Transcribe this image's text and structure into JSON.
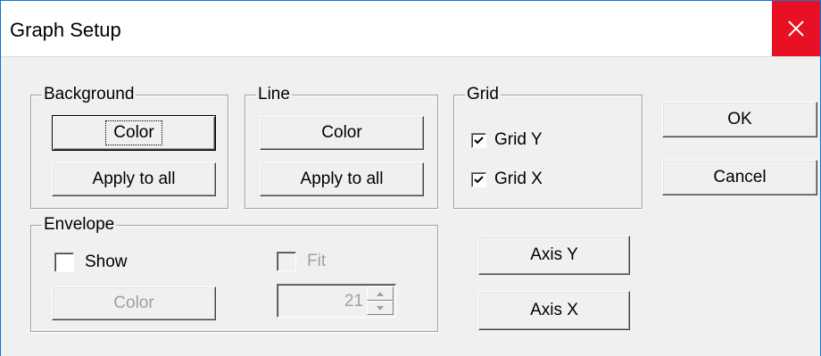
{
  "window": {
    "title": "Graph Setup"
  },
  "background": {
    "label": "Background",
    "color_button": "Color",
    "apply_button": "Apply to all"
  },
  "line": {
    "label": "Line",
    "color_button": "Color",
    "apply_button": "Apply to all"
  },
  "grid": {
    "label": "Grid",
    "grid_y": {
      "label": "Grid Y",
      "checked": true
    },
    "grid_x": {
      "label": "Grid X",
      "checked": true
    }
  },
  "envelope": {
    "label": "Envelope",
    "show": {
      "label": "Show",
      "checked": false
    },
    "fit": {
      "label": "Fit",
      "checked": false,
      "enabled": false
    },
    "color_button": "Color",
    "spin_value": "21"
  },
  "buttons": {
    "ok": "OK",
    "cancel": "Cancel",
    "axis_y": "Axis Y",
    "axis_x": "Axis X"
  },
  "colors": {
    "close_bg": "#e81123",
    "window_border": "#0a78d7",
    "face": "#f0f0f0",
    "disabled_text": "#a0a0a0"
  }
}
